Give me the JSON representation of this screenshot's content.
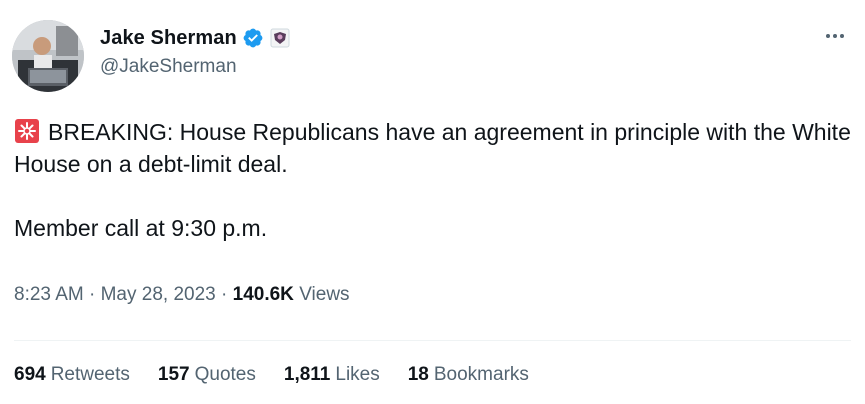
{
  "author": {
    "display_name": "Jake Sherman",
    "handle": "@JakeSherman",
    "verified_icon": "verified-badge-icon",
    "affiliate_icon": "affiliate-badge-icon",
    "accent_color": "#1d9bf0"
  },
  "tweet": {
    "emoji_icon": "rotating-light-icon",
    "line1": "BREAKING: House Republicans have an agreement in principle with the White House on a debt-limit deal.",
    "line2": "Member call at 9:30 p.m."
  },
  "meta": {
    "time": "8:23 AM",
    "separator": "·",
    "date": "May 28, 2023",
    "views_count": "140.6K",
    "views_label": "Views"
  },
  "stats": [
    {
      "count": "694",
      "label": "Retweets"
    },
    {
      "count": "157",
      "label": "Quotes"
    },
    {
      "count": "1,811",
      "label": "Likes"
    },
    {
      "count": "18",
      "label": "Bookmarks"
    }
  ]
}
